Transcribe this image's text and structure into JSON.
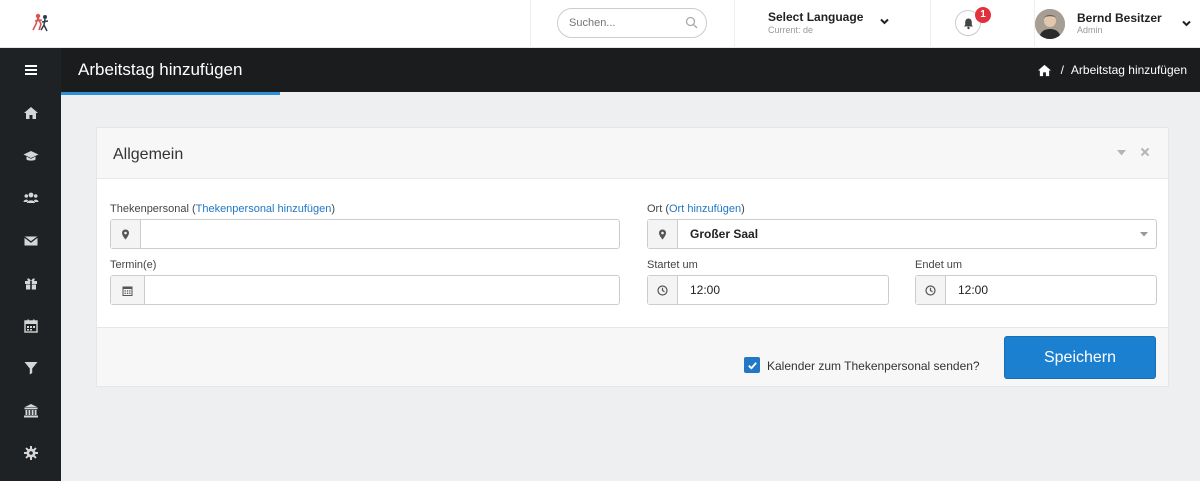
{
  "header": {
    "search_placeholder": "Suchen...",
    "language_title": "Select Language",
    "language_current": "Current: de",
    "notification_count": "1",
    "user_name": "Bernd Besitzer",
    "user_role": "Admin"
  },
  "titlebar": {
    "page_title": "Arbeitstag hinzufügen",
    "breadcrumb_sep": "/",
    "breadcrumb_current": "Arbeitstag hinzufügen"
  },
  "sidebar": {
    "icons": [
      "menu-icon",
      "home-icon",
      "graduation-cap-icon",
      "users-icon",
      "envelope-icon",
      "gift-icon",
      "calendar-icon",
      "filter-icon",
      "bank-icon",
      "gear-icon"
    ]
  },
  "panel": {
    "title": "Allgemein",
    "staff_label": "Thekenpersonal (",
    "staff_link": "Thekenpersonal hinzufügen",
    "staff_label_end": ")",
    "staff_value": "",
    "location_label": "Ort (",
    "location_link": "Ort hinzufügen",
    "location_label_end": ")",
    "location_value": "Großer Saal",
    "dates_label": "Termin(e)",
    "dates_value": "",
    "start_label": "Startet um",
    "start_value": "12:00",
    "end_label": "Endet um",
    "end_value": "12:00",
    "calendar_checkbox_label": "Kalender zum Thekenpersonal senden?",
    "calendar_checked": true,
    "save_label": "Speichern"
  },
  "colors": {
    "accent": "#2277c6",
    "sidebar_bg": "#1f2224",
    "titlebar_bg": "#1a1c1e",
    "badge": "#e0313c"
  }
}
